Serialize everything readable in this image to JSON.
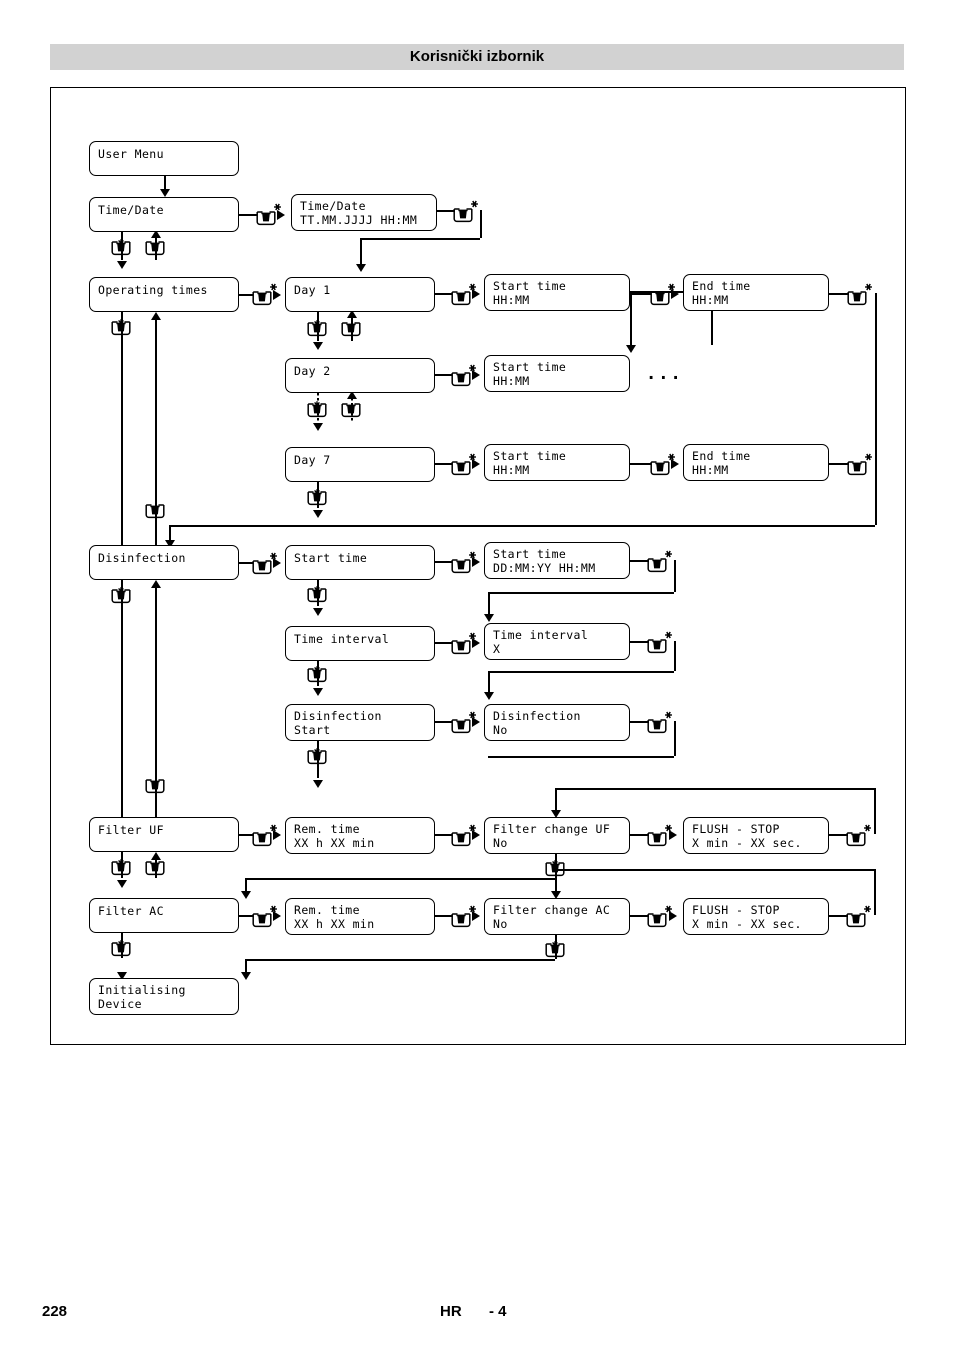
{
  "header": {
    "title": "Korisnički izbornik"
  },
  "footer": {
    "page": "228",
    "language": "HR",
    "section": "- 4"
  },
  "icons": {
    "press_star": "hand-press-button-star-icon",
    "press_down": "hand-press-button-down-icon",
    "press_up": "hand-press-button-up-icon",
    "arrow": "arrow-icon"
  },
  "ellipsis": "...",
  "boxes": {
    "user_menu": {
      "line1": "User Menu",
      "line2": ""
    },
    "time_date": {
      "line1": "Time/Date",
      "line2": ""
    },
    "time_date_val": {
      "line1": "Time/Date",
      "line2": "TT.MM.JJJJ  HH:MM"
    },
    "operating_times": {
      "line1": "Operating times",
      "line2": ""
    },
    "day1": {
      "line1": "Day 1",
      "line2": ""
    },
    "day1_start": {
      "line1": "Start time",
      "line2": "HH:MM"
    },
    "day1_end": {
      "line1": "End time",
      "line2": "HH:MM"
    },
    "day2": {
      "line1": "Day 2",
      "line2": ""
    },
    "day2_start": {
      "line1": "Start time",
      "line2": "HH:MM"
    },
    "day7": {
      "line1": "Day 7",
      "line2": ""
    },
    "day7_start": {
      "line1": "Start time",
      "line2": "HH:MM"
    },
    "day7_end": {
      "line1": "End time",
      "line2": "HH:MM"
    },
    "disinfection": {
      "line1": "Disinfection",
      "line2": ""
    },
    "dis_start": {
      "line1": "Start time",
      "line2": ""
    },
    "dis_start_val": {
      "line1": "Start time",
      "line2": "DD:MM:YY    HH:MM"
    },
    "time_interval": {
      "line1": "Time interval",
      "line2": ""
    },
    "time_interval_val": {
      "line1": "Time interval",
      "line2": " X"
    },
    "dis_start_menu": {
      "line1": "Disinfection",
      "line2": "Start"
    },
    "dis_start_no": {
      "line1": "Disinfection",
      "line2": "No"
    },
    "filter_uf": {
      "line1": "Filter UF",
      "line2": ""
    },
    "uf_rem_time": {
      "line1": "Rem. time",
      "line2": "XX h XX min"
    },
    "uf_change": {
      "line1": "Filter change UF",
      "line2": "No"
    },
    "uf_flush": {
      "line1": "FLUSH - STOP",
      "line2": " X min - XX sec."
    },
    "filter_ac": {
      "line1": "Filter AC",
      "line2": ""
    },
    "ac_rem_time": {
      "line1": "Rem. time",
      "line2": "XX h XX min"
    },
    "ac_change": {
      "line1": "Filter change AC",
      "line2": "No"
    },
    "ac_flush": {
      "line1": "FLUSH - STOP",
      "line2": " X min - XX sec."
    },
    "initialising": {
      "line1": "Initialising",
      "line2": "Device"
    }
  }
}
